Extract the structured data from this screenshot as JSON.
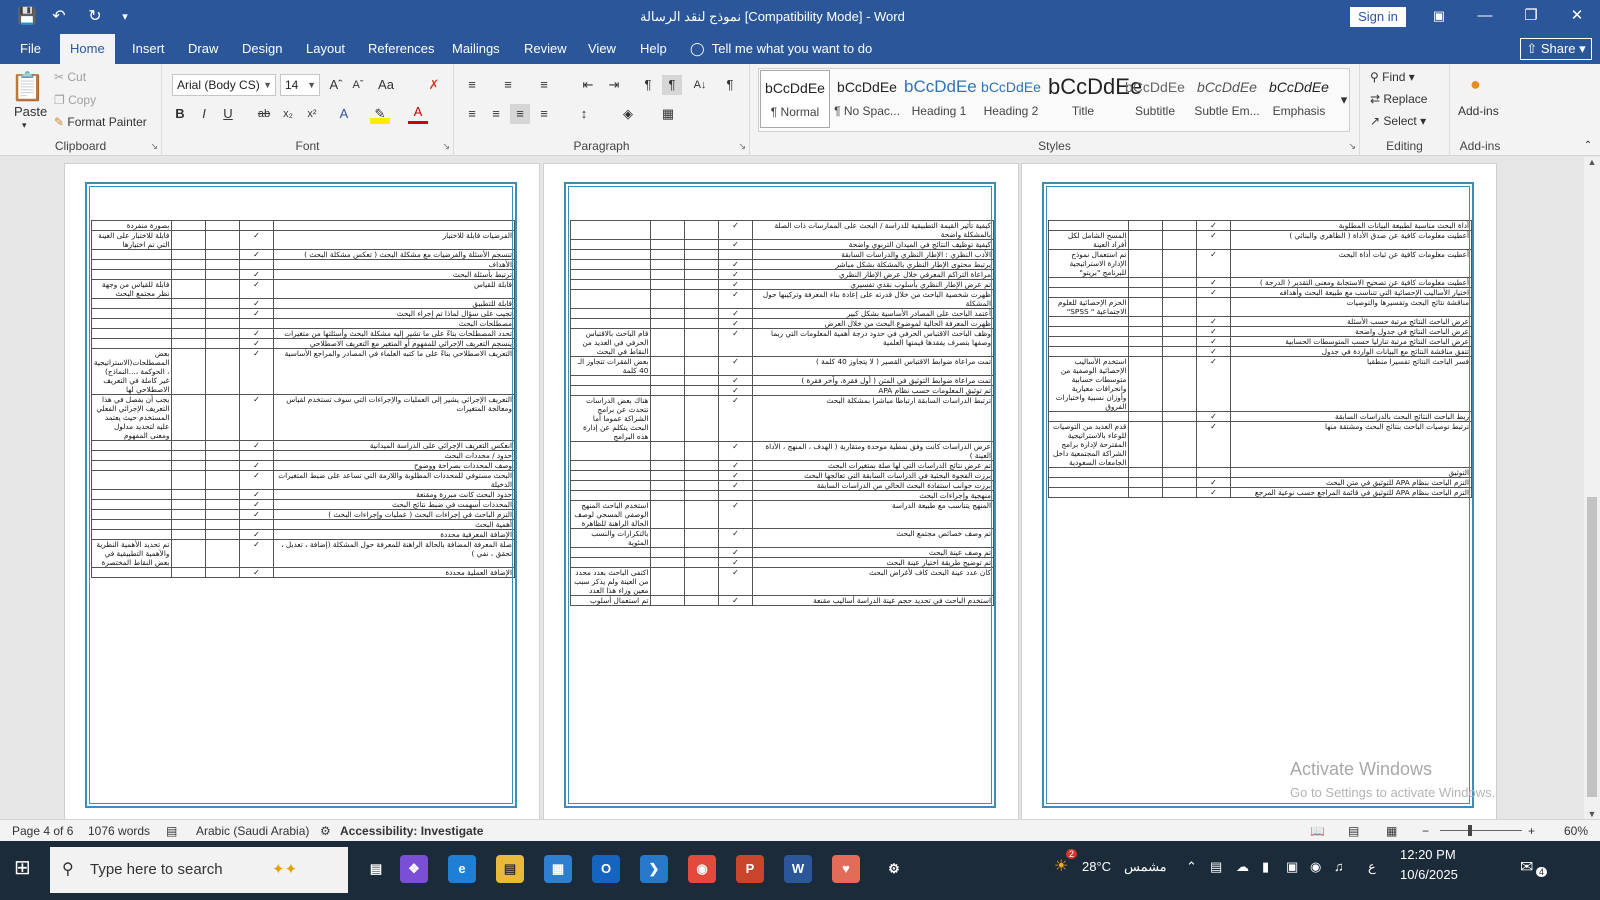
{
  "titlebar": {
    "doc_title": "نموذج لنقد الرسالة [Compatibility Mode] - Word",
    "sign_in": "Sign in",
    "share": "Share"
  },
  "tabs": [
    "File",
    "Home",
    "Insert",
    "Draw",
    "Design",
    "Layout",
    "References",
    "Mailings",
    "Review",
    "View",
    "Help"
  ],
  "tell_me": "Tell me what you want to do",
  "clipboard": {
    "paste": "Paste",
    "cut": "Cut",
    "copy": "Copy",
    "format_painter": "Format Painter",
    "label": "Clipboard"
  },
  "font": {
    "name": "Arial (Body CS)",
    "size": "14",
    "label": "Font"
  },
  "paragraph": {
    "label": "Paragraph"
  },
  "styles": {
    "label": "Styles",
    "items": [
      {
        "preview": "bCcDdEe",
        "name": "¶ Normal"
      },
      {
        "preview": "bCcDdEe",
        "name": "¶ No Spac..."
      },
      {
        "preview": "bCcDdEe",
        "name": "Heading 1"
      },
      {
        "preview": "bCcDdEe",
        "name": "Heading 2"
      },
      {
        "preview": "bCcDdEe",
        "name": "Title"
      },
      {
        "preview": "bCcDdEe",
        "name": "Subtitle"
      },
      {
        "preview": "bCcDdEe",
        "name": "Subtle Em..."
      },
      {
        "preview": "bCcDdEe",
        "name": "Emphasis"
      }
    ]
  },
  "editing": {
    "find": "Find",
    "replace": "Replace",
    "select": "Select",
    "label": "Editing"
  },
  "addins": {
    "button": "Add-ins",
    "label": "Add-ins"
  },
  "page3": [
    {
      "c": "أداة البحث مناسبة لطبيعة البيانات المطلوبة",
      "k": 1,
      "n": ""
    },
    {
      "c": "أعطيت معلومات كافية عن صدق الأداة ( الظاهري والبنائي )",
      "k": 1,
      "n": "المسح الشامل لكل أفراد العينة"
    },
    {
      "c": "أعطيت معلومات كافية عن ثبات أداة البحث",
      "k": 1,
      "n": "تم استعمال نموذج الإدارة الاستراتيجية للبرنامج \"بريتو\""
    },
    {
      "c": "أعطيت معلومات كافية عن تصحيح الاستجابة ومعنى التقدير ( الدرجة )",
      "k": 1,
      "n": ""
    },
    {
      "c": "اختيار الأساليب الإحصائية التي تتناسب مع طبيعة البحث وأهدافه",
      "k": 1,
      "n": ""
    },
    {
      "c": "مناقشة نتائج البحث وتفسيرها والتوصيات",
      "k": 0,
      "n": "الحزم الإحصائية للعلوم الاجتماعية \" SPSS\""
    },
    {
      "c": "عرض الباحث النتائج مرتبة حسب الأسئلة",
      "k": 1,
      "n": ""
    },
    {
      "c": "عرض الباحث النتائج في جدول واضحة",
      "k": 1,
      "n": ""
    },
    {
      "c": "عرض الباحث النتائج مرتبة تنازليا حسب المتوسطات الحسابية",
      "k": 1,
      "n": ""
    },
    {
      "c": "تتفق مناقشة النتائج مع البيانات الواردة في جدول",
      "k": 1,
      "n": ""
    },
    {
      "c": "فسر الباحث النتائج تفسيرا منطقيا",
      "k": 1,
      "n": "استخدم الأساليب الإحصائية الوصفية من متوسطات حسابية وانحرافات معيارية وأوزان نسبية واختبارات الفروق"
    },
    {
      "c": "ربط الباحث النتائج البحث بالدراسات السابقة",
      "k": 1,
      "n": ""
    },
    {
      "c": "ترتبط توصيات الباحث بنتائج البحث ومشتقة منها",
      "k": 1,
      "n": "قدم العديد من التوصيات للوعاء بالاستراتيجية المقترحة لإدارة برامج الشراكة المجتمعية داخل الجامعات السعودية"
    },
    {
      "c": "التوثيق",
      "k": 0,
      "n": ""
    },
    {
      "c": "التزم الباحث بنظام APA للتوثيق في متن البحث",
      "k": 1,
      "n": ""
    },
    {
      "c": "التزم الباحث بنظام APA للتوثيق في قائمة المراجع حسب نوعية المرجع",
      "k": 1,
      "n": ""
    }
  ],
  "page2": [
    {
      "c": "كيفية تأثير القيمة التطبيقية للدراسة / البحث على الممارسات ذات الصلة بالمشكلة واضحة",
      "k": 1,
      "n": ""
    },
    {
      "c": "كيفية توظيف النتائج في الميدان التربوي واضحة",
      "k": 1,
      "n": ""
    },
    {
      "c": "الأدب النظري : الإطار النظري والدراسات السابقة",
      "k": 0,
      "n": ""
    },
    {
      "c": "يرتبط محتوى الإطار النظري بالمشكلة بشكل مباشر",
      "k": 1,
      "n": ""
    },
    {
      "c": "مراعاة التراكم المعرفي خلال عرض الإطار النظري",
      "k": 1,
      "n": ""
    },
    {
      "c": "تم عرض الإطار النظري بأسلوب نقدي تفسيري",
      "k": 1,
      "n": ""
    },
    {
      "c": "ظهرت شخصية الباحث من خلال قدرته على إعادة بناء المعرفة وتركيبها حول المشكلة",
      "k": 1,
      "n": ""
    },
    {
      "c": "أعتمد الباحث على المصادر الأساسية بشكل كبير",
      "k": 1,
      "n": ""
    },
    {
      "c": "ظهرت المعرفة الحالية لموضوع البحث من خلال العرض",
      "k": 1,
      "n": ""
    },
    {
      "c": "وظف الباحث الاقتباس الحرفي في حدود درجة أهمية المعلومات التي ربما وصفها بتصرف يفقدها قيمتها العلمية",
      "k": 1,
      "n": "قام الباحث بالاقتباس الحرفي في العديد من النقاط في البحث"
    },
    {
      "c": "تمت مراعاة ضوابط الاقتباس القصير ( لا يتجاوز 40 كلمة )",
      "k": 1,
      "n": "بعض الفقرات تتجاوز الـ 40 كلمة"
    },
    {
      "c": "تمت مراعاة ضوابط التوثيق في المتن ( أول فقرة، وآخر فقرة )",
      "k": 1,
      "n": ""
    },
    {
      "c": "تم توثيق المعلومات حسب نظام APA",
      "k": 1,
      "n": ""
    },
    {
      "c": "ترتبط الدراسات السابقة ارتباطا مباشرا بمشكلة البحث",
      "k": 1,
      "n": "هناك بعض الدراسات تتحدث عن برامج الشراكة عموما أما البحث يتكلم عن إدارة هذه البرامج"
    },
    {
      "c": "عرض الدراسات كانت وفق نمطية موحدة ومتقاربة ( الهدف ، المنهج ، الأداة العينة )",
      "k": 1,
      "n": ""
    },
    {
      "c": "تم عرض نتائج الدراسات التي لها صلة بمتغيرات البحث",
      "k": 1,
      "n": ""
    },
    {
      "c": "برزت الفجوة البحثية في الدراسات السابقة التي تعالجها البحث",
      "k": 1,
      "n": ""
    },
    {
      "c": "برزت جوانب استفادة البحث الحالي من الدراسات السابقة",
      "k": 1,
      "n": ""
    },
    {
      "c": "منهجية وإجراءات البحث",
      "k": 0,
      "n": ""
    },
    {
      "c": "المنهج يتناسب مع طبيعة الدراسة",
      "k": 1,
      "n": "استخدم الباحث المنهج الوصفي المسحي لوصف الحالة الراهنة للظاهرة"
    },
    {
      "c": "تم وصف خصائص مجتمع البحث",
      "k": 1,
      "n": "بالتكرارات والنسب المئوية"
    },
    {
      "c": "تم وصف عينة البحث",
      "k": 1,
      "n": ""
    },
    {
      "c": "تم توضيح طريقة اختيار عينة البحث",
      "k": 1,
      "n": ""
    },
    {
      "c": "كان عدد عينة البحث كاف لأغراض البحث",
      "k": 1,
      "n": "اكتفى الباحث بعدد محدد من العينة ولم يذكر سبب معين وراء هذا العدد"
    },
    {
      "c": "استخدم الباحث في تحديد حجم عينة الدراسة أساليب مقنعة",
      "k": 1,
      "n": "تم استعمال أسلوب"
    }
  ],
  "page1": [
    {
      "c": "",
      "k": 0,
      "n": "بصورة منفردة"
    },
    {
      "c": "الفرضيات قابلة للاختبار",
      "k": 1,
      "n": "قابلة للاختبار على العينة التي تم اختيارها"
    },
    {
      "c": "تنسجم الأسئلة والفرضيات مع مشكلة البحث ( تعكس مشكلة البحث )",
      "k": 1,
      "n": ""
    },
    {
      "c": "الأهداف",
      "k": 0,
      "n": ""
    },
    {
      "c": "ترتبط بأسئلة البحث",
      "k": 1,
      "n": ""
    },
    {
      "c": "قابلة للقياس",
      "k": 1,
      "n": "قابلة للقياس من وجهة نظر مجتمع البحث"
    },
    {
      "c": "قابلة للتطبيق",
      "k": 1,
      "n": ""
    },
    {
      "c": "تجيب على سؤال لماذا تم إجراء البحث",
      "k": 1,
      "n": ""
    },
    {
      "c": "مصطلحات البحث",
      "k": 0,
      "n": ""
    },
    {
      "c": "تحدد المصطلحات بناءً على ما تشير إليه مشكلة البحث وأسئلتها من متغيرات",
      "k": 1,
      "n": ""
    },
    {
      "c": "ينسجم التعريف الإجرائي للمفهوم أو المتغير مع التعريف الاصطلاحي",
      "k": 1,
      "n": ""
    },
    {
      "c": "التعريف الاصطلاحي بناءً على ما كتبه العلماء في المصادر والمراجع الأساسية",
      "k": 1,
      "n": "بعض المصطلحات(الاستراتيجية ، الحوكمة ،...النماذج) غير كاملة في التعريف الاصطلاحي لها"
    },
    {
      "c": "التعريف الإجرائي يشير إلى العمليات والإجراءات التي سوف تستخدم لقياس ومعالجة المتغيرات",
      "k": 1,
      "n": "يجب أن يفصل في هذا التعريف الإجرائي الفعلي المستخدم حيث يعتمد عليه لتحديد مدلول ومعنى المفهوم"
    },
    {
      "c": "انعكس التعريف الإجرائي على الدراسة الميدانية",
      "k": 1,
      "n": ""
    },
    {
      "c": "حدود / محددات البحث",
      "k": 0,
      "n": ""
    },
    {
      "c": "وصف المحددات بصراحة ووضوح",
      "k": 1,
      "n": ""
    },
    {
      "c": "البحث مستوفي للمحددات المطلوبة واللازمة التي تساعد على ضبط المتغيرات الدخيلة",
      "k": 1,
      "n": ""
    },
    {
      "c": "حدود البحث كانت مبررة ومقنعة",
      "k": 1,
      "n": ""
    },
    {
      "c": "المحددات أسهمت في ضبط نتائج البحث",
      "k": 1,
      "n": ""
    },
    {
      "c": "التزم الباحث في إجراءات البحث ( عمليات وإجراءات البحث )",
      "k": 1,
      "n": ""
    },
    {
      "c": "أهمية البحث",
      "k": 0,
      "n": ""
    },
    {
      "c": "الإضافة المعرفية محددة",
      "k": 1,
      "n": ""
    },
    {
      "c": "صلة المعرفة المضافة بالحالة الراهنة للمعرفة حول المشكلة (إضافة ، تعديل ، تحقق ، نفي )",
      "k": 1,
      "n": "تم تحديد الأهمية النظرية والأهمية التطبيقية في بعض النقاط المختصرة"
    },
    {
      "c": "الإضافة العملية محددة",
      "k": 1,
      "n": ""
    }
  ],
  "watermark": {
    "line1": "Activate Windows",
    "line2": "Go to Settings to activate Windows."
  },
  "status": {
    "page": "Page 4 of 6",
    "words": "1076 words",
    "language": "Arabic (Saudi Arabia)",
    "accessibility": "Accessibility: Investigate",
    "zoom": "60%"
  },
  "taskbar": {
    "search_placeholder": "Type here to search",
    "weather_temp": "28°C",
    "weather_text": "مشمس",
    "lang": "ع",
    "time": "12:20 PM",
    "date": "10/6/2025",
    "notif_count": "4",
    "weather_badge": "2"
  }
}
